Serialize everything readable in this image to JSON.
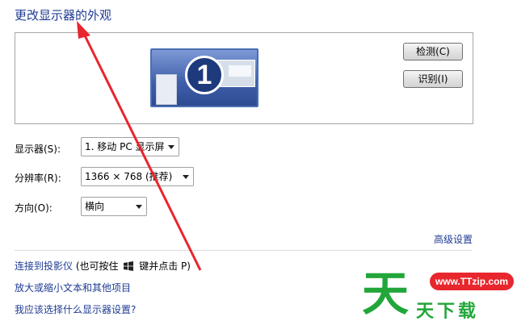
{
  "title": "更改显示器的外观",
  "preview": {
    "monitor_number": "1",
    "detect_button": "检测(C)",
    "identify_button": "识别(I)"
  },
  "settings": {
    "display_label": "显示器(S):",
    "display_value": "1. 移动 PC 显示屏",
    "resolution_label": "分辨率(R):",
    "resolution_value": "1366 × 768 (推荐)",
    "orientation_label": "方向(O):",
    "orientation_value": "横向"
  },
  "advanced_link": "高级设置",
  "links": {
    "projector": "连接到投影仪",
    "projector_hint_pre": "(也可按住",
    "projector_hint_post": "键并点击 P)",
    "text_size": "放大或缩小文本和其他项目",
    "which_settings": "我应该选择什么显示器设置?"
  },
  "watermark": {
    "url": "www.TTzip.com",
    "big": "天",
    "text": "天下载"
  },
  "colors": {
    "link": "#1e3b93",
    "arrow": "#e8262d",
    "watermark_green": "#22a63a"
  }
}
